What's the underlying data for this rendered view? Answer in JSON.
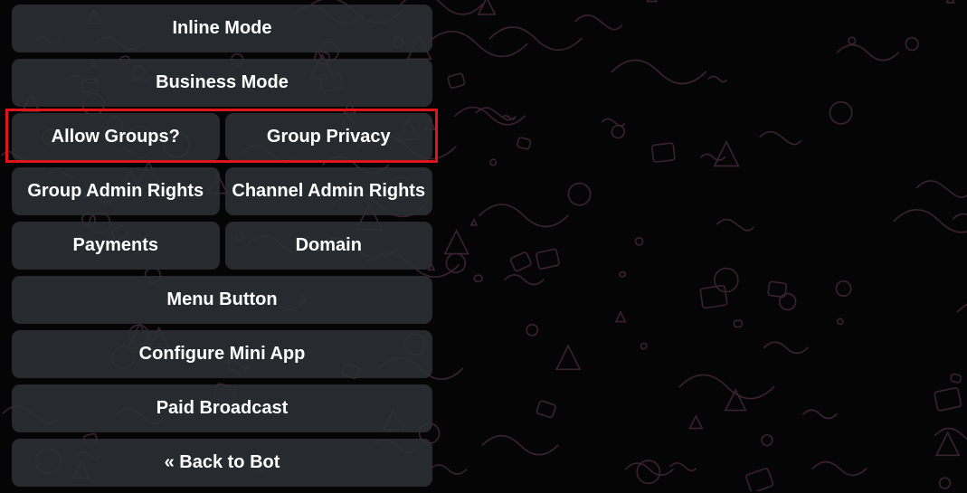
{
  "keyboard": {
    "rows": [
      [
        "Inline Mode"
      ],
      [
        "Business Mode"
      ],
      [
        "Allow Groups?",
        "Group Privacy"
      ],
      [
        "Group Admin Rights",
        "Channel Admin Rights"
      ],
      [
        "Payments",
        "Domain"
      ],
      [
        "Menu Button"
      ],
      [
        "Configure Mini App"
      ],
      [
        "Paid Broadcast"
      ],
      [
        "« Back to Bot"
      ]
    ]
  },
  "colors": {
    "background": "#060506",
    "doodle_stroke": "#3a2232",
    "button_fill": "#2c3036",
    "button_text": "#ffffff",
    "highlight": "#e0141b"
  },
  "icons": [
    "doodle-pattern"
  ]
}
